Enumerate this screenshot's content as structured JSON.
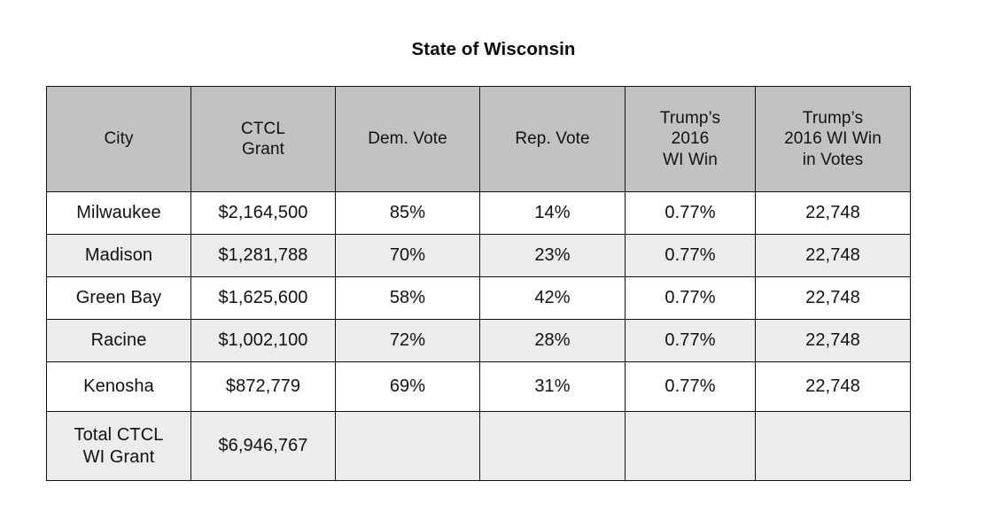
{
  "page": {
    "title": "State of Wisconsin",
    "background_color": "#ffffff",
    "header_fill": "#c2c2c2",
    "stripe_fill": "#ececec",
    "border_color": "#111111"
  },
  "table": {
    "columns": [
      {
        "key": "city",
        "lines": [
          "City"
        ]
      },
      {
        "key": "grant",
        "lines": [
          "CTCL",
          "Grant"
        ]
      },
      {
        "key": "dem",
        "lines": [
          "Dem. Vote"
        ]
      },
      {
        "key": "rep",
        "lines": [
          "Rep. Vote"
        ]
      },
      {
        "key": "win",
        "lines": [
          "Trump’s",
          "2016",
          "WI Win"
        ]
      },
      {
        "key": "votes",
        "lines": [
          "Trump’s",
          "2016 WI Win",
          "in Votes"
        ]
      }
    ],
    "rows": [
      {
        "city": "Milwaukee",
        "grant": "$2,164,500",
        "dem": "85%",
        "rep": "14%",
        "win": "0.77%",
        "votes": "22,748"
      },
      {
        "city": "Madison",
        "grant": "$1,281,788",
        "dem": "70%",
        "rep": "23%",
        "win": "0.77%",
        "votes": "22,748"
      },
      {
        "city": "Green Bay",
        "grant": "$1,625,600",
        "dem": "58%",
        "rep": "42%",
        "win": "0.77%",
        "votes": "22,748"
      },
      {
        "city": "Racine",
        "grant": "$1,002,100",
        "dem": "72%",
        "rep": "28%",
        "win": "0.77%",
        "votes": "22,748"
      },
      {
        "city": "Kenosha",
        "grant": "$872,779",
        "dem": "69%",
        "rep": "31%",
        "win": "0.77%",
        "votes": "22,748"
      }
    ],
    "total_row": {
      "label_lines": [
        "Total CTCL",
        "WI Grant"
      ],
      "grant": "$6,946,767",
      "dem": "",
      "rep": "",
      "win": "",
      "votes": ""
    }
  },
  "chart_data": {
    "type": "table",
    "title": "State of Wisconsin",
    "columns": [
      "City",
      "CTCL Grant",
      "Dem. Vote",
      "Rep. Vote",
      "Trump’s 2016 WI Win",
      "Trump’s 2016 WI Win in Votes"
    ],
    "rows": [
      [
        "Milwaukee",
        "$2,164,500",
        "85%",
        "14%",
        "0.77%",
        "22,748"
      ],
      [
        "Madison",
        "$1,281,788",
        "70%",
        "23%",
        "0.77%",
        "22,748"
      ],
      [
        "Green Bay",
        "$1,625,600",
        "58%",
        "42%",
        "0.77%",
        "22,748"
      ],
      [
        "Racine",
        "$1,002,100",
        "72%",
        "28%",
        "0.77%",
        "22,748"
      ],
      [
        "Kenosha",
        "$872,779",
        "69%",
        "31%",
        "0.77%",
        "22,748"
      ],
      [
        "Total CTCL WI Grant",
        "$6,946,767",
        "",
        "",
        "",
        ""
      ]
    ],
    "grant_values": [
      2164500,
      1281788,
      1625600,
      1002100,
      872779
    ],
    "grant_total": 6946767,
    "dem_vote_pct": [
      85,
      70,
      58,
      72,
      69
    ],
    "rep_vote_pct": [
      14,
      23,
      42,
      28,
      31
    ],
    "trump_2016_wi_win_pct": [
      0.77,
      0.77,
      0.77,
      0.77,
      0.77
    ],
    "trump_2016_wi_win_votes": [
      22748,
      22748,
      22748,
      22748,
      22748
    ]
  }
}
